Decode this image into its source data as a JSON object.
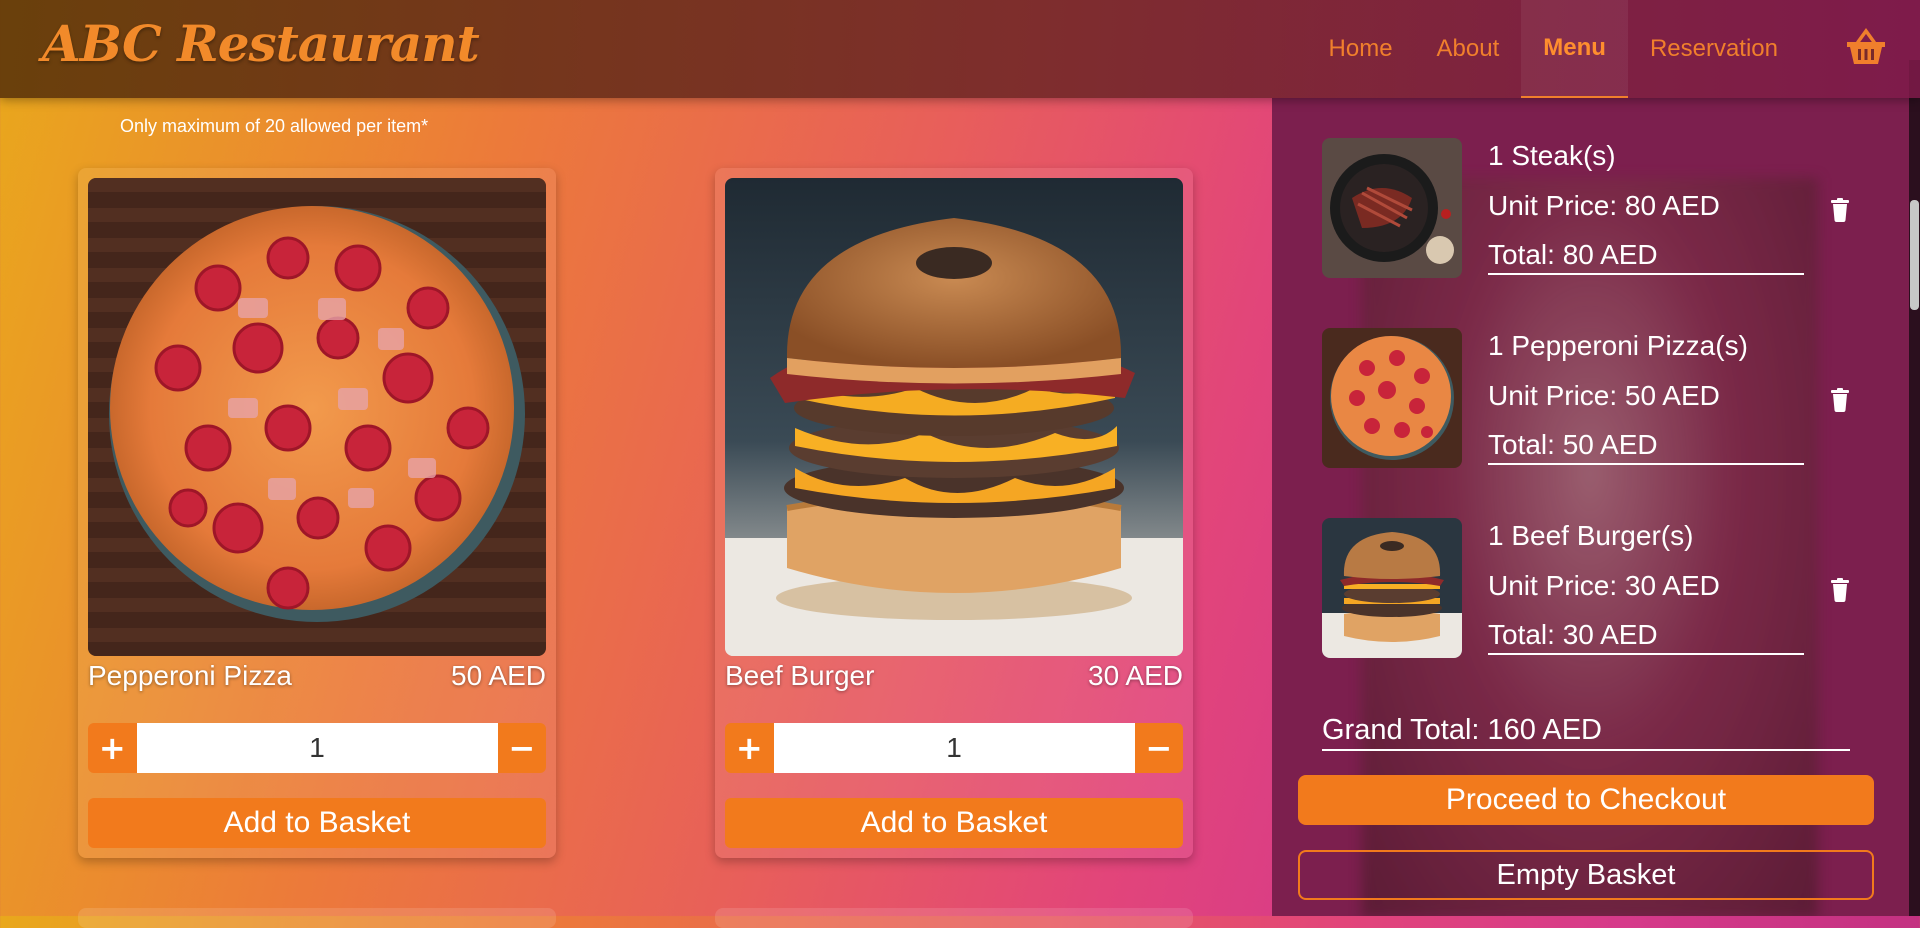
{
  "brand": "ABC Restaurant",
  "nav": {
    "items": [
      {
        "label": "Home"
      },
      {
        "label": "About"
      },
      {
        "label": "Menu",
        "active": true
      },
      {
        "label": "Reservation"
      }
    ],
    "basket_icon": "basket-icon"
  },
  "menu": {
    "notice": "Only maximum of 20 allowed per item*",
    "items": [
      {
        "name": "Pepperoni Pizza",
        "price": "50 AED",
        "qty": "1",
        "plus": "+",
        "minus": "−",
        "add_label": "Add to Basket"
      },
      {
        "name": "Beef Burger",
        "price": "30 AED",
        "qty": "1",
        "plus": "+",
        "minus": "−",
        "add_label": "Add to Basket"
      }
    ]
  },
  "basket": {
    "items": [
      {
        "title": "1 Steak(s)",
        "unit": "Unit Price: 80 AED",
        "total": "Total: 80 AED"
      },
      {
        "title": "1 Pepperoni Pizza(s)",
        "unit": "Unit Price: 50 AED",
        "total": "Total: 50 AED"
      },
      {
        "title": "1 Beef Burger(s)",
        "unit": "Unit Price: 30 AED",
        "total": "Total: 30 AED"
      }
    ],
    "grand_total": "Grand Total: 160 AED",
    "checkout_label": "Proceed to Checkout",
    "empty_label": "Empty Basket"
  },
  "colors": {
    "accent": "#f27a1c",
    "panel": "#7c1f4e"
  }
}
